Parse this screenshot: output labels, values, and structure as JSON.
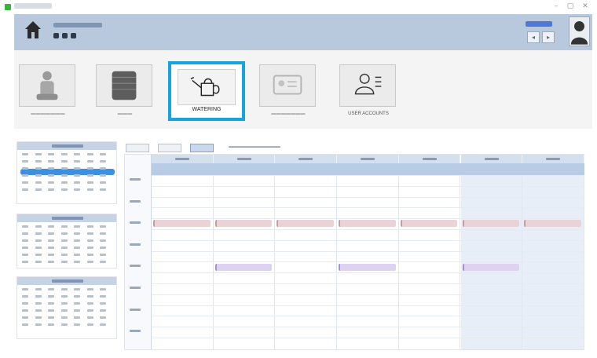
{
  "window": {
    "controls": [
      "–",
      "▢",
      "✕"
    ]
  },
  "header": {
    "icons": [
      "home-icon",
      "header-icon-1",
      "header-icon-2",
      "header-icon-3"
    ],
    "buttons": [
      "◂",
      "▸"
    ],
    "avatar_icon": "person-silhouette-icon"
  },
  "toolbar": {
    "items": [
      {
        "key": "experiments",
        "icon": "scientist-icon"
      },
      {
        "key": "trays",
        "icon": "tray-icon"
      },
      {
        "key": "watering",
        "icon": "watering-can-icon",
        "label": "WATERING",
        "selected": true
      },
      {
        "key": "user-profile",
        "icon": "id-card-icon"
      },
      {
        "key": "user-accounts",
        "icon": "user-list-icon",
        "label": "USER ACCOUNTS"
      }
    ]
  },
  "colors": {
    "accent_selected": "#15a4dd",
    "header_band": "#b8c9de",
    "event_watering": "#ead3d5",
    "event_fertilizer": "#ddd2ef",
    "weekend_column": "#e8eef8"
  },
  "calendar": {
    "mini_calendars": 3,
    "week_days": 7,
    "weekend_days": [
      5,
      6
    ]
  }
}
